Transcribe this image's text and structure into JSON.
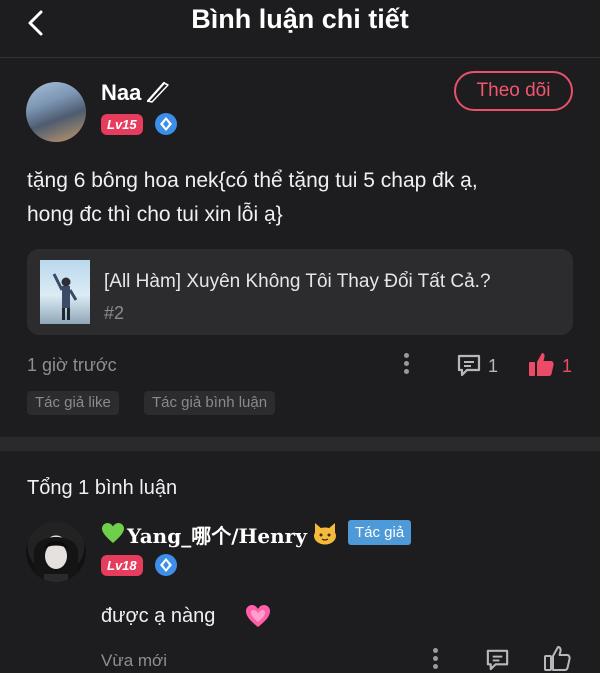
{
  "header": {
    "title": "Bình luận chi tiết",
    "back_icon": "chevron-left-icon"
  },
  "post": {
    "username": "Naa",
    "name_icon": "pencil-icon",
    "level": "Lv15",
    "rank_icon": "diamond-rank-icon",
    "follow_label": "Theo dõi",
    "comment_line1": "tặng 6 bông hoa nek{có thể tặng tui 5 chap đk ạ,",
    "comment_line2": "hong đc thì cho tui xin lỗi ạ}",
    "story": {
      "title": "[All Hàm] Xuyên Không Tôi Thay Đổi Tất Cả.?",
      "chapter": "#2"
    },
    "time": "1 giờ trước",
    "comment_count": "1",
    "like_count": "1",
    "tags": [
      "Tác giả like",
      "Tác giả bình luận"
    ]
  },
  "replies_section": {
    "total_label": "Tổng 1 bình luận",
    "replies": [
      {
        "username": "Yang_哪个/Henry",
        "prefix_emoji": "green-heart",
        "suffix_emoji": "cat-face",
        "author_badge": "Tác giả",
        "level": "Lv18",
        "text": "được ạ nàng",
        "text_emoji": "pink-heart",
        "time": "Vừa mới"
      }
    ]
  },
  "colors": {
    "background": "#1d1d1f",
    "accent_pink": "#e8506b",
    "author_blue": "#4e9ad9",
    "rank_blue": "#3d8ee8",
    "muted_text": "#8e8e93"
  }
}
